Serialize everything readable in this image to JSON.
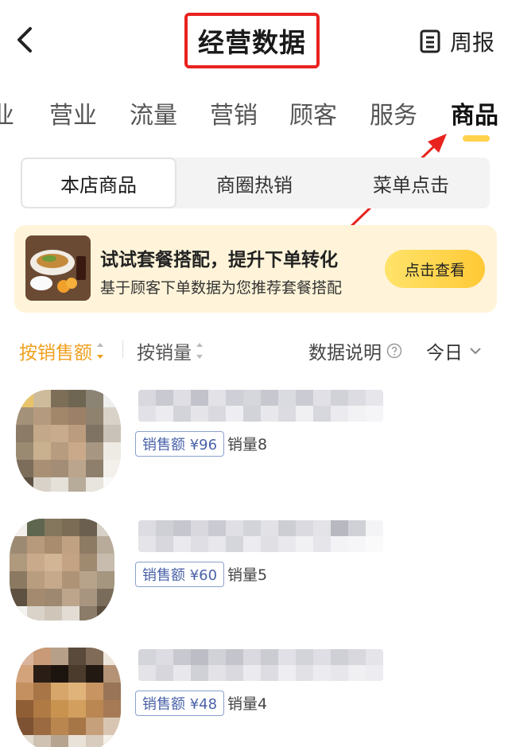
{
  "header": {
    "title": "经营数据",
    "weekly_label": "周报",
    "back_icon": "chevron-left-icon",
    "weekly_icon": "report-icon"
  },
  "tabs": [
    {
      "label": "业",
      "active": false
    },
    {
      "label": "营业",
      "active": false
    },
    {
      "label": "流量",
      "active": false
    },
    {
      "label": "营销",
      "active": false
    },
    {
      "label": "顾客",
      "active": false
    },
    {
      "label": "服务",
      "active": false
    },
    {
      "label": "商品",
      "active": true
    }
  ],
  "segments": [
    {
      "label": "本店商品",
      "active": true
    },
    {
      "label": "商圈热销",
      "active": false
    },
    {
      "label": "菜单点击",
      "active": false
    }
  ],
  "promo": {
    "title": "试试套餐搭配，提升下单转化",
    "subtitle": "基于顾客下单数据为您推荐套餐搭配",
    "button": "点击查看"
  },
  "sortbar": {
    "by_sales": "按销售额",
    "by_qty": "按销量",
    "data_info": "数据说明",
    "date": "今日"
  },
  "products": [
    {
      "badge": "销售额 ¥96",
      "qty": "销量8"
    },
    {
      "badge": "销售额 ¥60",
      "qty": "销量5"
    },
    {
      "badge": "销售额 ¥48",
      "qty": "销量4"
    }
  ],
  "colors": {
    "accent": "#f0a020",
    "title_highlight": "#e8231f",
    "promo_bg": "#fff4d9",
    "badge_text": "#4a62a8"
  }
}
